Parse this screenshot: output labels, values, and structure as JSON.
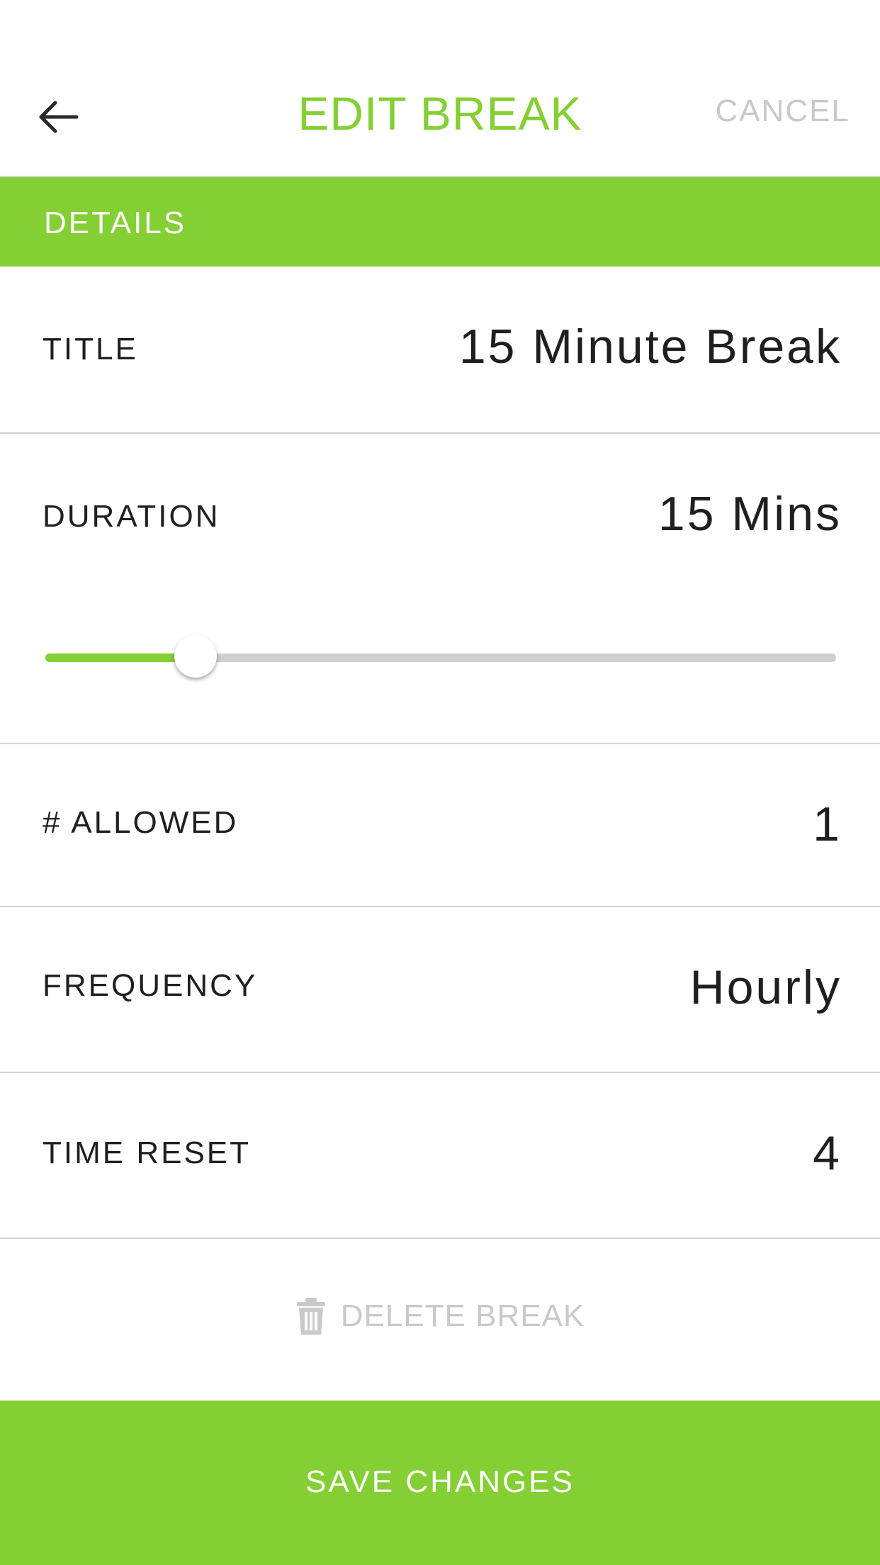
{
  "header": {
    "back_icon": "arrow-left-icon",
    "title": "EDIT BREAK",
    "cancel_label": "CANCEL"
  },
  "section": {
    "label": "DETAILS"
  },
  "fields": {
    "title": {
      "label": "TITLE",
      "value": "15 Minute Break"
    },
    "duration": {
      "label": "DURATION",
      "value": "15 Mins",
      "slider_fraction": 0.19
    },
    "allowed": {
      "label": "# ALLOWED",
      "value": "1"
    },
    "frequency": {
      "label": "FREQUENCY",
      "value": "Hourly"
    },
    "time_reset": {
      "label": "TIME RESET",
      "value": "4"
    }
  },
  "delete": {
    "icon": "trash-icon",
    "label": "DELETE BREAK"
  },
  "save": {
    "label": "SAVE CHANGES"
  },
  "colors": {
    "accent": "#84cf33",
    "muted": "#c9c9c9",
    "text": "#1f1f1f"
  }
}
